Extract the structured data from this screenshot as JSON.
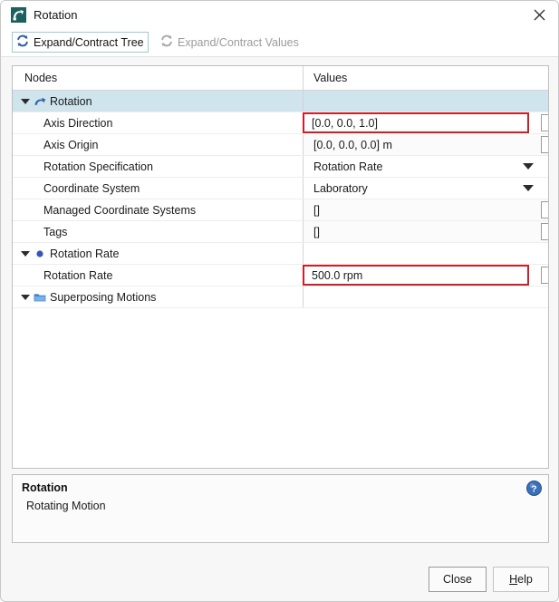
{
  "window": {
    "title": "Rotation",
    "icon": "rotation-app-icon",
    "close_icon": "close-icon"
  },
  "toolbar": {
    "items": [
      {
        "label": "Expand/Contract Tree",
        "icon": "refresh-sync-icon",
        "state": "active"
      },
      {
        "label": "Expand/Contract Values",
        "icon": "refresh-sync-icon",
        "state": "disabled"
      }
    ]
  },
  "table": {
    "headers": {
      "nodes": "Nodes",
      "values": "Values"
    },
    "rows": [
      {
        "label": "Rotation",
        "indent": 0,
        "twisty": "open",
        "icon": "curved-arrow-icon",
        "selected": true,
        "value": "",
        "control": "none"
      },
      {
        "label": "Axis Direction",
        "indent": 1,
        "twisty": "none",
        "icon": "none",
        "selected": false,
        "value": "[0.0, 0.0, 1.0]",
        "control": "ellipsis-outside",
        "highlight": true
      },
      {
        "label": "Axis Origin",
        "indent": 1,
        "twisty": "none",
        "icon": "none",
        "selected": false,
        "value": "[0.0, 0.0, 0.0] m",
        "control": "ellipsis-outside",
        "highlight": false
      },
      {
        "label": "Rotation Specification",
        "indent": 1,
        "twisty": "none",
        "icon": "none",
        "selected": false,
        "value": "Rotation Rate",
        "control": "dropdown",
        "highlight": false
      },
      {
        "label": "Coordinate System",
        "indent": 1,
        "twisty": "none",
        "icon": "none",
        "selected": false,
        "value": "Laboratory",
        "control": "dropdown",
        "highlight": false
      },
      {
        "label": "Managed Coordinate Systems",
        "indent": 1,
        "twisty": "none",
        "icon": "none",
        "selected": false,
        "value": "[]",
        "control": "ellipsis-outside",
        "highlight": false
      },
      {
        "label": "Tags",
        "indent": 1,
        "twisty": "none",
        "icon": "none",
        "selected": false,
        "value": "[]",
        "control": "ellipsis-outside",
        "highlight": false
      },
      {
        "label": "Rotation Rate",
        "indent": 0,
        "twisty": "open",
        "icon": "blue-dot-icon",
        "selected": false,
        "value": "",
        "control": "none",
        "highlight": false
      },
      {
        "label": "Rotation Rate",
        "indent": 1,
        "twisty": "none",
        "icon": "none",
        "selected": false,
        "value": "500.0 rpm",
        "control": "ellipsis-outside",
        "highlight": true
      },
      {
        "label": "Superposing Motions",
        "indent": 0,
        "twisty": "open",
        "icon": "folder-icon",
        "selected": false,
        "value": "",
        "control": "none",
        "highlight": false
      }
    ],
    "ellipsis_label": "..."
  },
  "info": {
    "title": "Rotation",
    "description": "Rotating Motion",
    "help_icon": "help-circle-icon"
  },
  "footer": {
    "close_label": "Close",
    "help_label": "Help",
    "help_mnemonic": "H",
    "help_rest": "elp"
  },
  "colors": {
    "selection": "#cfe4ec",
    "highlight_border": "#cc2026",
    "accent_blue": "#2d5fa6",
    "folder_blue": "#3f7fd0",
    "title_icon": "#1d6060"
  }
}
